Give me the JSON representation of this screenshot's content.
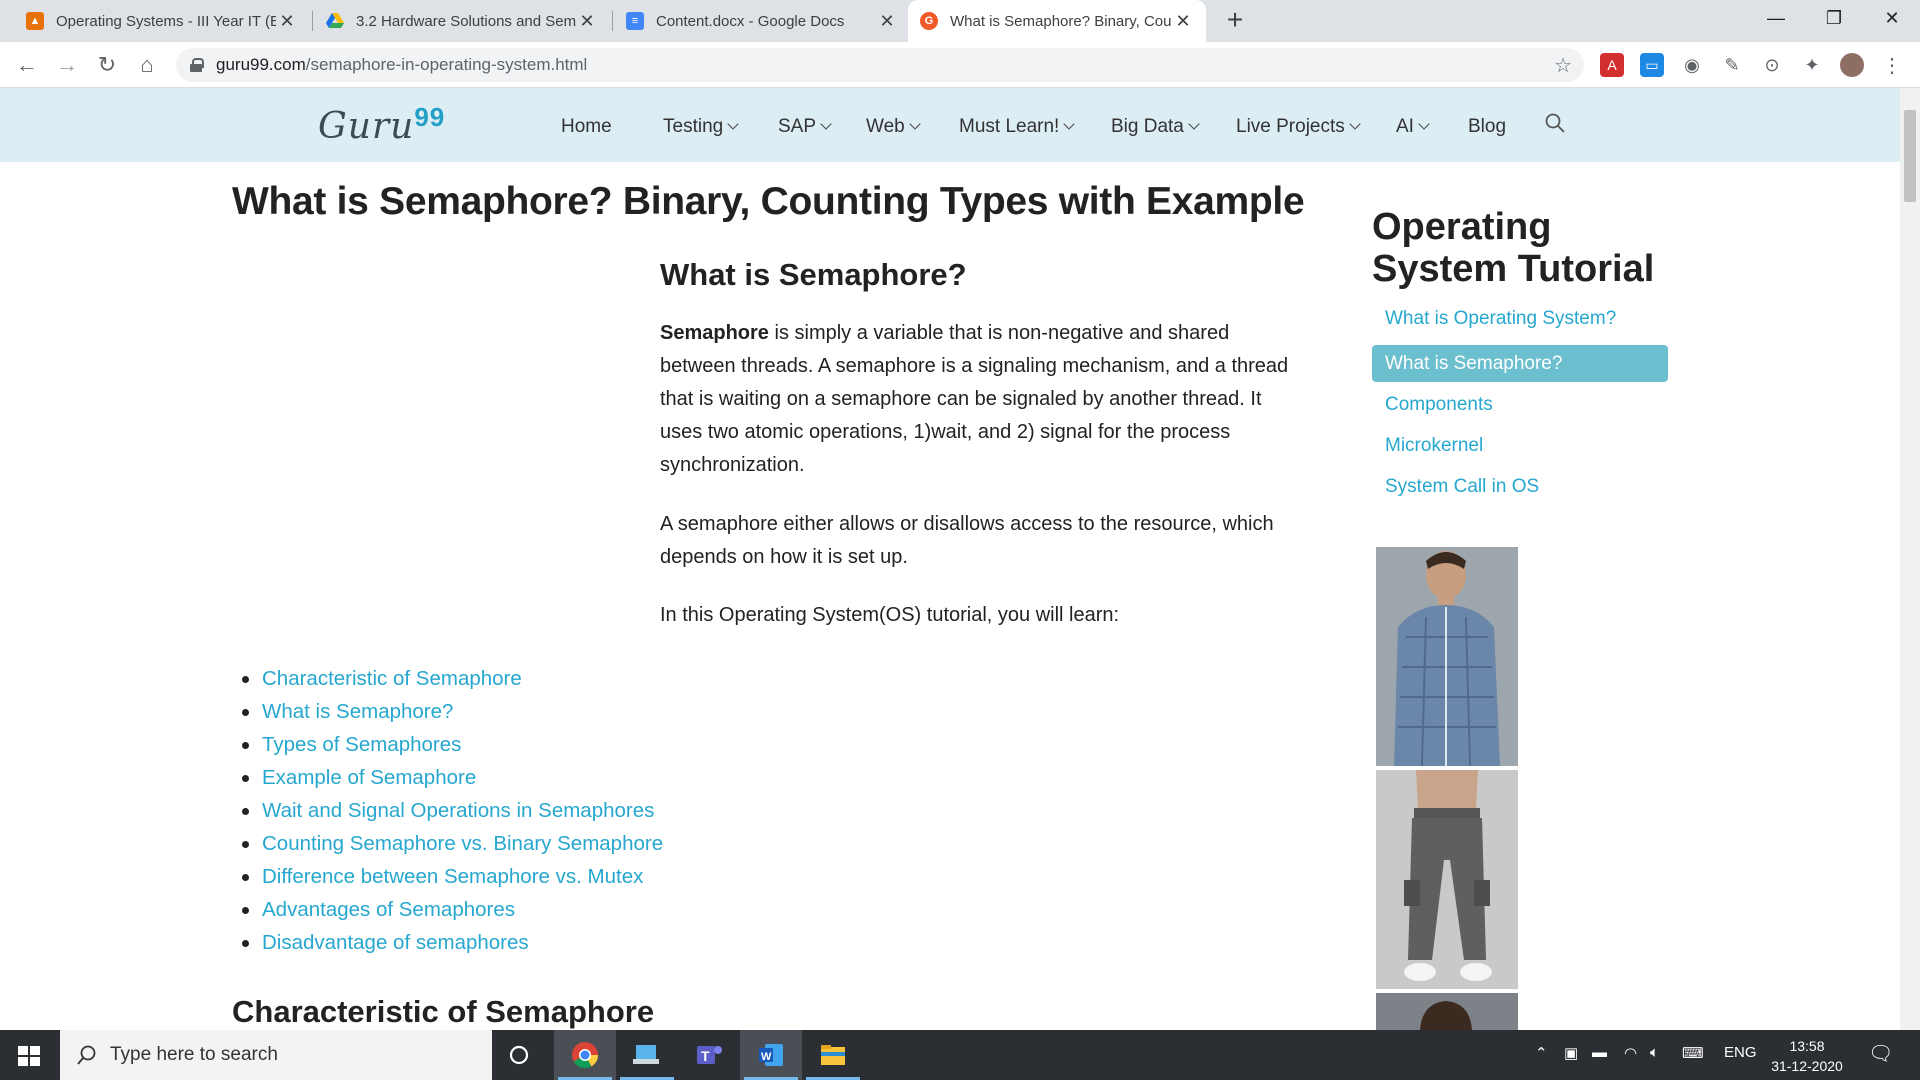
{
  "browser": {
    "tabs": [
      {
        "title": "Operating Systems - III Year IT (B",
        "active": false
      },
      {
        "title": "3.2 Hardware Solutions and Sema",
        "active": false
      },
      {
        "title": "Content.docx - Google Docs",
        "active": false
      },
      {
        "title": "What is Semaphore? Binary, Cour",
        "active": true
      }
    ],
    "url_domain": "guru99.com",
    "url_path": "/semaphore-in-operating-system.html"
  },
  "site": {
    "logo_text": "Guru",
    "logo_num": "99",
    "menu": [
      {
        "label": "Home",
        "dropdown": false
      },
      {
        "label": "Testing",
        "dropdown": true
      },
      {
        "label": "SAP",
        "dropdown": true
      },
      {
        "label": "Web",
        "dropdown": true
      },
      {
        "label": "Must Learn!",
        "dropdown": true
      },
      {
        "label": "Big Data",
        "dropdown": true
      },
      {
        "label": "Live Projects",
        "dropdown": true
      },
      {
        "label": "AI",
        "dropdown": true
      },
      {
        "label": "Blog",
        "dropdown": false
      }
    ]
  },
  "article": {
    "title": "What is Semaphore? Binary, Counting Types with Example",
    "section_heading": "What is Semaphore?",
    "para1_bold": "Semaphore",
    "para1_rest": " is simply a variable that is non-negative and shared between threads. A semaphore is a signaling mechanism, and a thread that is waiting on a semaphore can be signaled by another thread. It uses two atomic operations, 1)wait, and 2) signal for the process synchronization.",
    "para2": "A semaphore either allows or disallows access to the resource, which depends on how it is set up.",
    "para3": "In this Operating System(OS) tutorial, you will learn:",
    "toc": [
      "Characteristic of Semaphore",
      "What is Semaphore?",
      "Types of Semaphores",
      "Example of Semaphore",
      "Wait and Signal Operations in Semaphores",
      "Counting Semaphore vs. Binary Semaphore",
      "Difference between Semaphore vs. Mutex",
      "Advantages of Semaphores",
      "Disadvantage of semaphores"
    ],
    "next_heading": "Characteristic of Semaphore"
  },
  "sidebar": {
    "title": "Operating System Tutorial",
    "links": [
      {
        "label": "What is Operating System?",
        "active": false
      },
      {
        "label": "What is Semaphore?",
        "active": true
      },
      {
        "label": "Components",
        "active": false
      },
      {
        "label": "Microkernel",
        "active": false
      },
      {
        "label": "System Call in OS",
        "active": false
      }
    ]
  },
  "taskbar": {
    "search_placeholder": "Type here to search",
    "language": "ENG",
    "time": "13:58",
    "date": "31-12-2020"
  },
  "colors": {
    "link": "#26a7cf",
    "header_bg": "#dcedf4",
    "sidebar_active": "#6cbfce"
  }
}
